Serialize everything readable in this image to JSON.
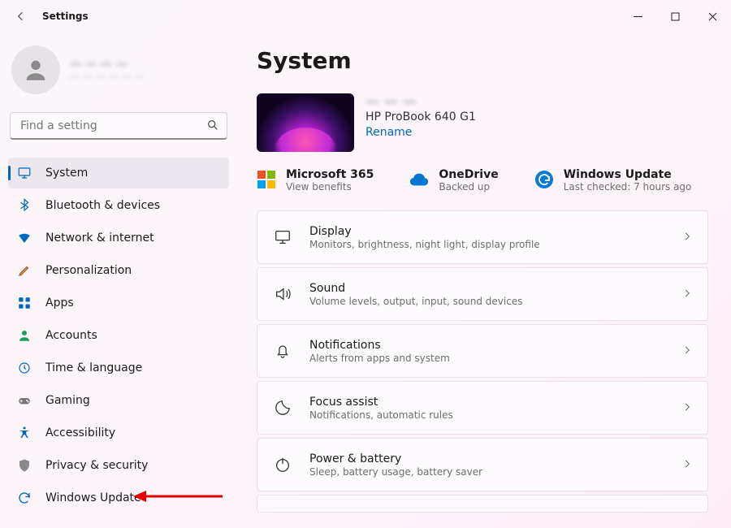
{
  "window": {
    "title": "Settings"
  },
  "profile": {
    "name": "— — — —",
    "email": "— — — — — —"
  },
  "search": {
    "placeholder": "Find a setting"
  },
  "sidebar": {
    "items": [
      {
        "key": "system",
        "label": "System",
        "selected": true
      },
      {
        "key": "bluetooth",
        "label": "Bluetooth & devices",
        "selected": false
      },
      {
        "key": "network",
        "label": "Network & internet",
        "selected": false
      },
      {
        "key": "personalize",
        "label": "Personalization",
        "selected": false
      },
      {
        "key": "apps",
        "label": "Apps",
        "selected": false
      },
      {
        "key": "accounts",
        "label": "Accounts",
        "selected": false
      },
      {
        "key": "time",
        "label": "Time & language",
        "selected": false
      },
      {
        "key": "gaming",
        "label": "Gaming",
        "selected": false
      },
      {
        "key": "accessibility",
        "label": "Accessibility",
        "selected": false
      },
      {
        "key": "privacy",
        "label": "Privacy & security",
        "selected": false
      },
      {
        "key": "update",
        "label": "Windows Update",
        "selected": false
      }
    ]
  },
  "page": {
    "title": "System",
    "device": {
      "name": "— — —",
      "model": "HP ProBook 640 G1",
      "rename": "Rename"
    },
    "status": [
      {
        "key": "m365",
        "title": "Microsoft 365",
        "sub": "View benefits"
      },
      {
        "key": "onedrive",
        "title": "OneDrive",
        "sub": "Backed up"
      },
      {
        "key": "update",
        "title": "Windows Update",
        "sub": "Last checked: 7 hours ago"
      }
    ],
    "cards": [
      {
        "key": "display",
        "title": "Display",
        "sub": "Monitors, brightness, night light, display profile"
      },
      {
        "key": "sound",
        "title": "Sound",
        "sub": "Volume levels, output, input, sound devices"
      },
      {
        "key": "notif",
        "title": "Notifications",
        "sub": "Alerts from apps and system"
      },
      {
        "key": "focus",
        "title": "Focus assist",
        "sub": "Notifications, automatic rules"
      },
      {
        "key": "power",
        "title": "Power & battery",
        "sub": "Sleep, battery usage, battery saver"
      }
    ]
  }
}
